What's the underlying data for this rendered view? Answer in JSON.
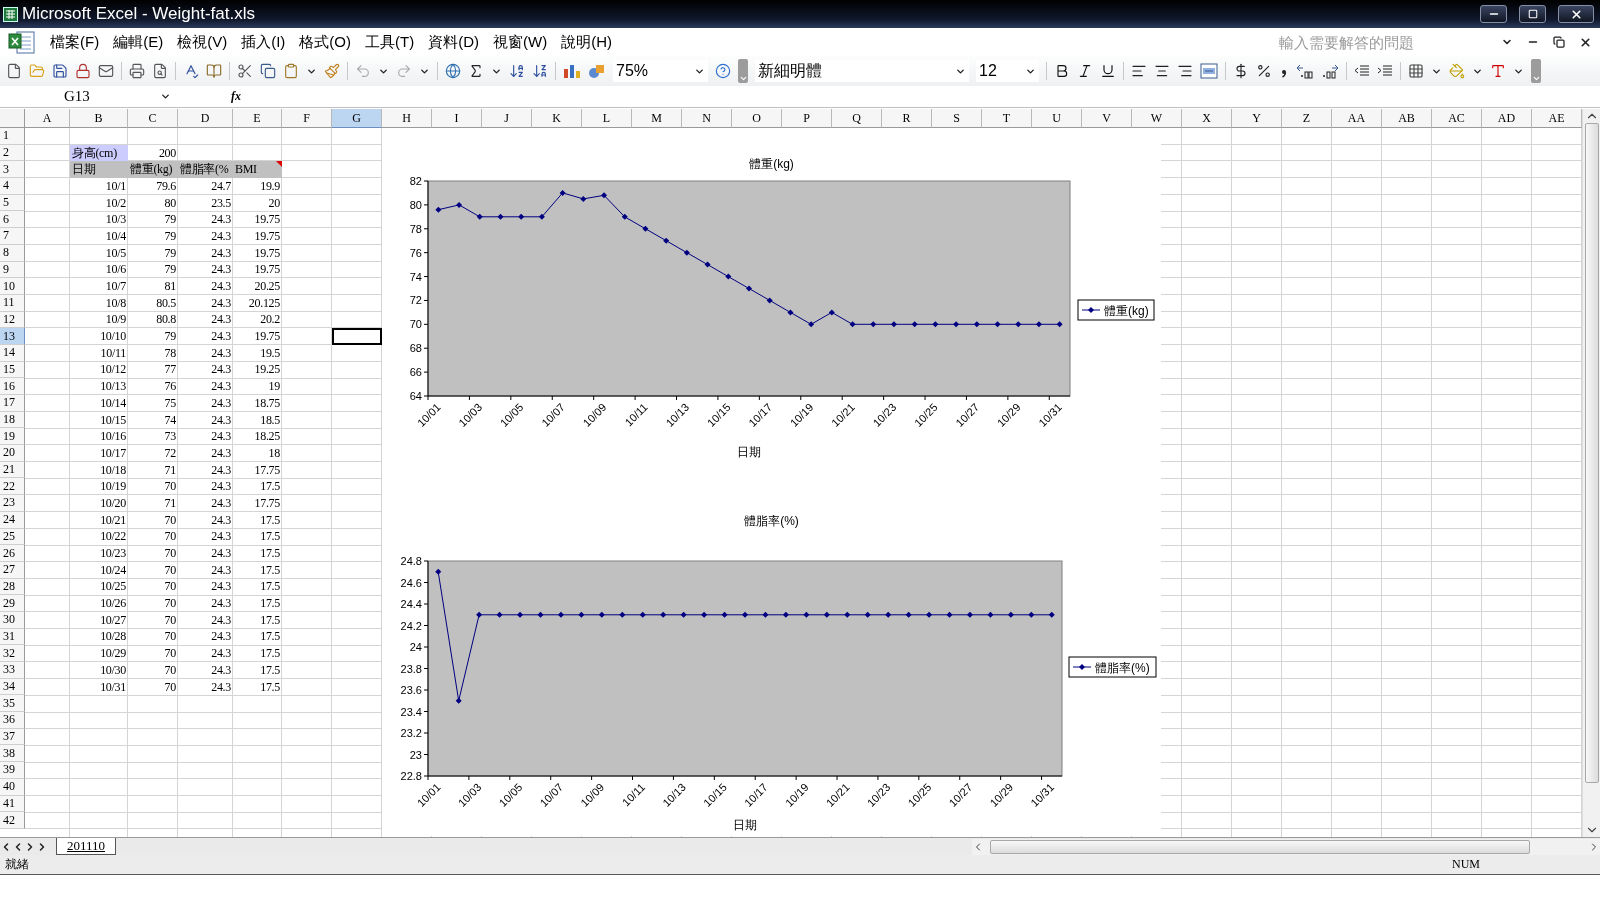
{
  "window": {
    "title": "Microsoft Excel - Weight-fat.xls"
  },
  "menu": [
    "檔案(F)",
    "編輯(E)",
    "檢視(V)",
    "插入(I)",
    "格式(O)",
    "工具(T)",
    "資料(D)",
    "視窗(W)",
    "說明(H)"
  ],
  "help_field": {
    "placeholder": "輸入需要解答的問題"
  },
  "toolbar": {
    "zoom": "75%",
    "font": "新細明體",
    "font_size": "12"
  },
  "formula_bar": {
    "name_box": "G13",
    "function_label": "fx"
  },
  "sheet": {
    "columns": [
      {
        "label": "A",
        "selected": false
      },
      {
        "label": "B",
        "selected": false
      },
      {
        "label": "C",
        "selected": false
      },
      {
        "label": "D",
        "selected": false
      },
      {
        "label": "E",
        "selected": false
      },
      {
        "label": "F",
        "selected": false
      },
      {
        "label": "G",
        "selected": true
      },
      {
        "label": "H",
        "selected": false
      },
      {
        "label": "I",
        "selected": false
      },
      {
        "label": "J",
        "selected": false
      },
      {
        "label": "K",
        "selected": false
      },
      {
        "label": "L",
        "selected": false
      },
      {
        "label": "M",
        "selected": false
      },
      {
        "label": "N",
        "selected": false
      },
      {
        "label": "O",
        "selected": false
      },
      {
        "label": "P",
        "selected": false
      },
      {
        "label": "Q",
        "selected": false
      },
      {
        "label": "R",
        "selected": false
      },
      {
        "label": "S",
        "selected": false
      },
      {
        "label": "T",
        "selected": false
      },
      {
        "label": "U",
        "selected": false
      },
      {
        "label": "V",
        "selected": false
      },
      {
        "label": "W",
        "selected": false
      },
      {
        "label": "X",
        "selected": false
      },
      {
        "label": "Y",
        "selected": false
      },
      {
        "label": "Z",
        "selected": false
      },
      {
        "label": "AA",
        "selected": false
      },
      {
        "label": "AB",
        "selected": false
      },
      {
        "label": "AC",
        "selected": false
      },
      {
        "label": "AD",
        "selected": false
      },
      {
        "label": "AE",
        "selected": false
      }
    ],
    "rows": [
      {
        "number": "1",
        "selected": false,
        "kind": "blank"
      },
      {
        "number": "2",
        "selected": false,
        "kind": "height",
        "label": "身高(cm)",
        "value": "200"
      },
      {
        "number": "3",
        "selected": false,
        "kind": "header",
        "headers": [
          "日期",
          "體重(kg)",
          "體脂率(%",
          "BMI"
        ],
        "comment": true
      },
      {
        "number": "4",
        "selected": false,
        "kind": "record",
        "date": "10/1",
        "weight": "79.6",
        "fat": "24.7",
        "bmi": "19.9"
      },
      {
        "number": "5",
        "selected": false,
        "kind": "record",
        "date": "10/2",
        "weight": "80",
        "fat": "23.5",
        "bmi": "20"
      },
      {
        "number": "6",
        "selected": false,
        "kind": "record",
        "date": "10/3",
        "weight": "79",
        "fat": "24.3",
        "bmi": "19.75"
      },
      {
        "number": "7",
        "selected": false,
        "kind": "record",
        "date": "10/4",
        "weight": "79",
        "fat": "24.3",
        "bmi": "19.75"
      },
      {
        "number": "8",
        "selected": false,
        "kind": "record",
        "date": "10/5",
        "weight": "79",
        "fat": "24.3",
        "bmi": "19.75"
      },
      {
        "number": "9",
        "selected": false,
        "kind": "record",
        "date": "10/6",
        "weight": "79",
        "fat": "24.3",
        "bmi": "19.75"
      },
      {
        "number": "10",
        "selected": false,
        "kind": "record",
        "date": "10/7",
        "weight": "81",
        "fat": "24.3",
        "bmi": "20.25"
      },
      {
        "number": "11",
        "selected": false,
        "kind": "record",
        "date": "10/8",
        "weight": "80.5",
        "fat": "24.3",
        "bmi": "20.125"
      },
      {
        "number": "12",
        "selected": false,
        "kind": "record",
        "date": "10/9",
        "weight": "80.8",
        "fat": "24.3",
        "bmi": "20.2"
      },
      {
        "number": "13",
        "selected": true,
        "kind": "record",
        "date": "10/10",
        "weight": "79",
        "fat": "24.3",
        "bmi": "19.75"
      },
      {
        "number": "14",
        "selected": false,
        "kind": "record",
        "date": "10/11",
        "weight": "78",
        "fat": "24.3",
        "bmi": "19.5"
      },
      {
        "number": "15",
        "selected": false,
        "kind": "record",
        "date": "10/12",
        "weight": "77",
        "fat": "24.3",
        "bmi": "19.25"
      },
      {
        "number": "16",
        "selected": false,
        "kind": "record",
        "date": "10/13",
        "weight": "76",
        "fat": "24.3",
        "bmi": "19"
      },
      {
        "number": "17",
        "selected": false,
        "kind": "record",
        "date": "10/14",
        "weight": "75",
        "fat": "24.3",
        "bmi": "18.75"
      },
      {
        "number": "18",
        "selected": false,
        "kind": "record",
        "date": "10/15",
        "weight": "74",
        "fat": "24.3",
        "bmi": "18.5"
      },
      {
        "number": "19",
        "selected": false,
        "kind": "record",
        "date": "10/16",
        "weight": "73",
        "fat": "24.3",
        "bmi": "18.25"
      },
      {
        "number": "20",
        "selected": false,
        "kind": "record",
        "date": "10/17",
        "weight": "72",
        "fat": "24.3",
        "bmi": "18"
      },
      {
        "number": "21",
        "selected": false,
        "kind": "record",
        "date": "10/18",
        "weight": "71",
        "fat": "24.3",
        "bmi": "17.75"
      },
      {
        "number": "22",
        "selected": false,
        "kind": "record",
        "date": "10/19",
        "weight": "70",
        "fat": "24.3",
        "bmi": "17.5"
      },
      {
        "number": "23",
        "selected": false,
        "kind": "record",
        "date": "10/20",
        "weight": "71",
        "fat": "24.3",
        "bmi": "17.75"
      },
      {
        "number": "24",
        "selected": false,
        "kind": "record",
        "date": "10/21",
        "weight": "70",
        "fat": "24.3",
        "bmi": "17.5"
      },
      {
        "number": "25",
        "selected": false,
        "kind": "record",
        "date": "10/22",
        "weight": "70",
        "fat": "24.3",
        "bmi": "17.5"
      },
      {
        "number": "26",
        "selected": false,
        "kind": "record",
        "date": "10/23",
        "weight": "70",
        "fat": "24.3",
        "bmi": "17.5"
      },
      {
        "number": "27",
        "selected": false,
        "kind": "record",
        "date": "10/24",
        "weight": "70",
        "fat": "24.3",
        "bmi": "17.5"
      },
      {
        "number": "28",
        "selected": false,
        "kind": "record",
        "date": "10/25",
        "weight": "70",
        "fat": "24.3",
        "bmi": "17.5"
      },
      {
        "number": "29",
        "selected": false,
        "kind": "record",
        "date": "10/26",
        "weight": "70",
        "fat": "24.3",
        "bmi": "17.5"
      },
      {
        "number": "30",
        "selected": false,
        "kind": "record",
        "date": "10/27",
        "weight": "70",
        "fat": "24.3",
        "bmi": "17.5"
      },
      {
        "number": "31",
        "selected": false,
        "kind": "record",
        "date": "10/28",
        "weight": "70",
        "fat": "24.3",
        "bmi": "17.5"
      },
      {
        "number": "32",
        "selected": false,
        "kind": "record",
        "date": "10/29",
        "weight": "70",
        "fat": "24.3",
        "bmi": "17.5"
      },
      {
        "number": "33",
        "selected": false,
        "kind": "record",
        "date": "10/30",
        "weight": "70",
        "fat": "24.3",
        "bmi": "17.5"
      },
      {
        "number": "34",
        "selected": false,
        "kind": "record",
        "date": "10/31",
        "weight": "70",
        "fat": "24.3",
        "bmi": "17.5"
      },
      {
        "number": "35",
        "selected": false,
        "kind": "blank"
      },
      {
        "number": "36",
        "selected": false,
        "kind": "blank"
      },
      {
        "number": "37",
        "selected": false,
        "kind": "blank"
      },
      {
        "number": "38",
        "selected": false,
        "kind": "blank"
      },
      {
        "number": "39",
        "selected": false,
        "kind": "blank"
      },
      {
        "number": "40",
        "selected": false,
        "kind": "blank"
      },
      {
        "number": "41",
        "selected": false,
        "kind": "blank"
      },
      {
        "number": "42",
        "selected": false,
        "kind": "blank"
      }
    ]
  },
  "charts": [
    {
      "chart_data": {
        "type": "line",
        "title": "體重(kg)",
        "xlabel": "日期",
        "categories": [
          "10/01",
          null,
          "10/03",
          null,
          "10/05",
          null,
          "10/07",
          null,
          "10/09",
          null,
          "10/11",
          null,
          "10/13",
          null,
          "10/15",
          null,
          "10/17",
          null,
          "10/19",
          null,
          "10/21",
          null,
          "10/23",
          null,
          "10/25",
          null,
          "10/27",
          null,
          "10/29",
          null,
          "10/31"
        ],
        "ylim": [
          64,
          82
        ],
        "yticks": [
          64,
          66,
          68,
          70,
          72,
          74,
          76,
          78,
          80,
          82
        ],
        "series": [
          {
            "name": "體重(kg)",
            "color": "#000080",
            "marker": "diamond",
            "values": [
              79.6,
              80,
              79,
              79,
              79,
              79,
              81,
              80.5,
              80.8,
              79,
              78,
              77,
              76,
              75,
              74,
              73,
              72,
              71,
              70,
              71,
              70,
              70,
              70,
              70,
              70,
              70,
              70,
              70,
              70,
              70,
              70
            ]
          }
        ]
      }
    },
    {
      "chart_data": {
        "type": "line",
        "title": "體脂率(%)",
        "xlabel": "日期",
        "categories": [
          "10/01",
          null,
          "10/03",
          null,
          "10/05",
          null,
          "10/07",
          null,
          "10/09",
          null,
          "10/11",
          null,
          "10/13",
          null,
          "10/15",
          null,
          "10/17",
          null,
          "10/19",
          null,
          "10/21",
          null,
          "10/23",
          null,
          "10/25",
          null,
          "10/27",
          null,
          "10/29",
          null,
          "10/31"
        ],
        "ylim": [
          22.8,
          24.8
        ],
        "yticks": [
          22.8,
          23,
          23.2,
          23.4,
          23.6,
          23.8,
          24,
          24.2,
          24.4,
          24.6,
          24.8
        ],
        "series": [
          {
            "name": "體脂率(%)",
            "color": "#000080",
            "marker": "diamond",
            "values": [
              24.7,
              23.5,
              24.3,
              24.3,
              24.3,
              24.3,
              24.3,
              24.3,
              24.3,
              24.3,
              24.3,
              24.3,
              24.3,
              24.3,
              24.3,
              24.3,
              24.3,
              24.3,
              24.3,
              24.3,
              24.3,
              24.3,
              24.3,
              24.3,
              24.3,
              24.3,
              24.3,
              24.3,
              24.3,
              24.3,
              24.3
            ]
          }
        ]
      }
    }
  ],
  "sheet_tabs": [
    {
      "label": "201110",
      "selected": true
    }
  ],
  "status_bar": {
    "left": "就緒",
    "right": "NUM"
  }
}
